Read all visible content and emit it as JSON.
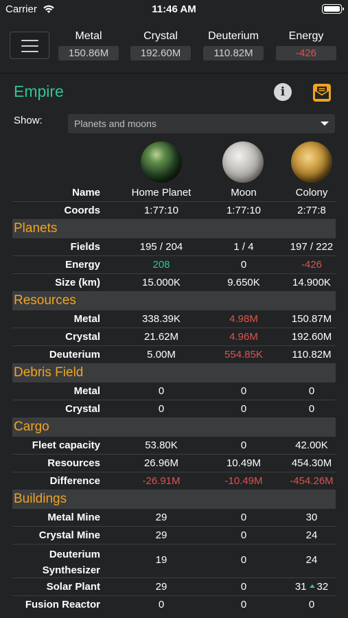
{
  "status_bar": {
    "carrier": "Carrier",
    "time": "11:46 AM"
  },
  "header": {
    "resources": [
      {
        "name": "Metal",
        "value": "150.86M"
      },
      {
        "name": "Crystal",
        "value": "192.60M"
      },
      {
        "name": "Deuterium",
        "value": "110.82M"
      },
      {
        "name": "Energy",
        "value": "-426"
      }
    ]
  },
  "page": {
    "title": "Empire",
    "show_label": "Show:",
    "show_selected": "Planets and moons"
  },
  "columns": [
    {
      "name": "Home Planet",
      "coords": "1:77:10"
    },
    {
      "name": "Moon",
      "coords": "1:77:10"
    },
    {
      "name": "Colony",
      "coords": "2:77:8"
    }
  ],
  "table": {
    "name_label": "Name",
    "coords_label": "Coords",
    "sections": {
      "planets": "Planets",
      "resources": "Resources",
      "debris": "Debris Field",
      "cargo": "Cargo",
      "buildings": "Buildings"
    },
    "planets": {
      "fields": {
        "label": "Fields",
        "values": [
          "195 / 204",
          "1 / 4",
          "197 / 222"
        ]
      },
      "energy": {
        "label": "Energy",
        "values": [
          "208",
          "0",
          "-426"
        ]
      },
      "size": {
        "label": "Size (km)",
        "values": [
          "15.000K",
          "9.650K",
          "14.900K"
        ]
      }
    },
    "resources": {
      "metal": {
        "label": "Metal",
        "values": [
          "338.39K",
          "4.98M",
          "150.87M"
        ]
      },
      "crystal": {
        "label": "Crystal",
        "values": [
          "21.62M",
          "4.96M",
          "192.60M"
        ]
      },
      "deuterium": {
        "label": "Deuterium",
        "values": [
          "5.00M",
          "554.85K",
          "110.82M"
        ]
      }
    },
    "debris": {
      "metal": {
        "label": "Metal",
        "values": [
          "0",
          "0",
          "0"
        ]
      },
      "crystal": {
        "label": "Crystal",
        "values": [
          "0",
          "0",
          "0"
        ]
      }
    },
    "cargo": {
      "fleet_capacity": {
        "label": "Fleet capacity",
        "values": [
          "53.80K",
          "0",
          "42.00K"
        ]
      },
      "resources": {
        "label": "Resources",
        "values": [
          "26.96M",
          "10.49M",
          "454.30M"
        ]
      },
      "difference": {
        "label": "Difference",
        "values": [
          "-26.91M",
          "-10.49M",
          "-454.26M"
        ]
      }
    },
    "buildings": {
      "metal_mine": {
        "label": "Metal Mine",
        "values": [
          "29",
          "0",
          "30"
        ]
      },
      "crystal_mine": {
        "label": "Crystal Mine",
        "values": [
          "29",
          "0",
          "24"
        ]
      },
      "deuterium_synth": {
        "label_line1": "Deuterium",
        "label_line2": "Synthesizer",
        "values": [
          "19",
          "0",
          "24"
        ]
      },
      "solar_plant": {
        "label": "Solar Plant",
        "values": [
          "29",
          "0",
          "31"
        ],
        "upgrade_target": "32"
      },
      "fusion_reactor": {
        "label": "Fusion Reactor",
        "values": [
          "0",
          "0",
          "0"
        ]
      }
    }
  },
  "colors": {
    "accent_green": "#2fc49a",
    "section_orange": "#f0a41f",
    "negative_red": "#e0524b",
    "background": "#222325"
  }
}
